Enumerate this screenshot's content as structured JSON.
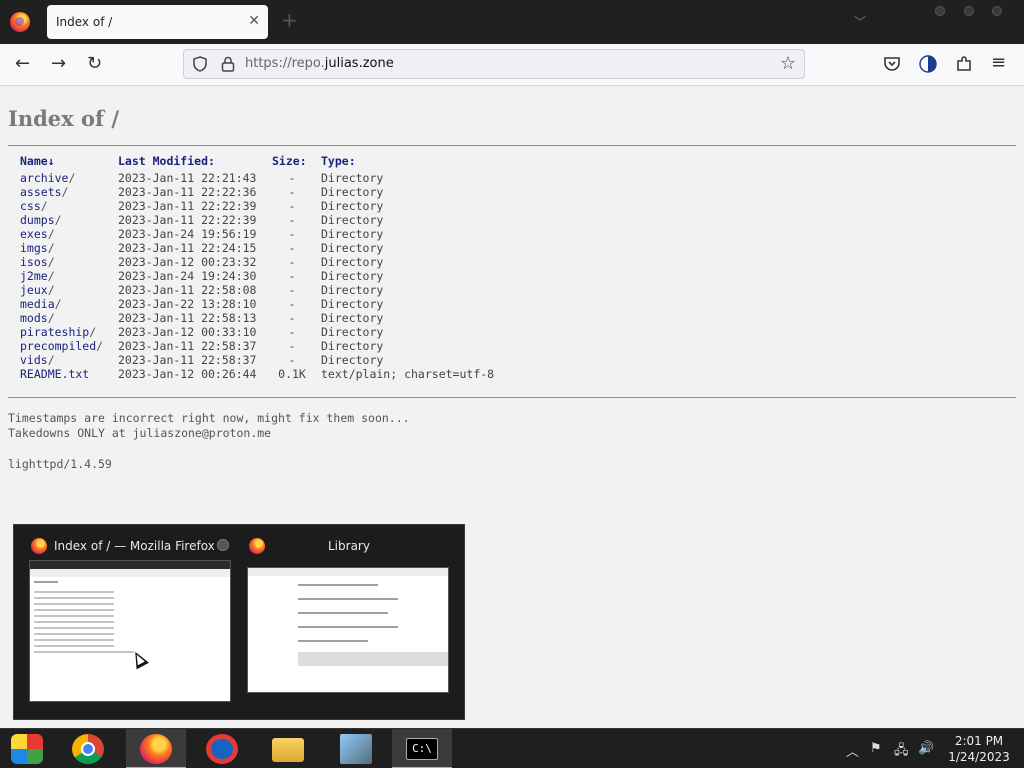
{
  "browser": {
    "tab_title": "Index of /",
    "url_prefix": "https://repo.",
    "url_domain": "julias.zone"
  },
  "page": {
    "title": "Index of /",
    "columns": {
      "name": "Name↓",
      "modified": "Last Modified:",
      "size": "Size:",
      "type": "Type:"
    },
    "rows": [
      {
        "name": "archive",
        "slash": "/",
        "modified": "2023-Jan-11 22:21:43",
        "size": "-",
        "type": "Directory"
      },
      {
        "name": "assets",
        "slash": "/",
        "modified": "2023-Jan-11 22:22:36",
        "size": "-",
        "type": "Directory"
      },
      {
        "name": "css",
        "slash": "/",
        "modified": "2023-Jan-11 22:22:39",
        "size": "-",
        "type": "Directory"
      },
      {
        "name": "dumps",
        "slash": "/",
        "modified": "2023-Jan-11 22:22:39",
        "size": "-",
        "type": "Directory"
      },
      {
        "name": "exes",
        "slash": "/",
        "modified": "2023-Jan-24 19:56:19",
        "size": "-",
        "type": "Directory"
      },
      {
        "name": "imgs",
        "slash": "/",
        "modified": "2023-Jan-11 22:24:15",
        "size": "-",
        "type": "Directory"
      },
      {
        "name": "isos",
        "slash": "/",
        "modified": "2023-Jan-12 00:23:32",
        "size": "-",
        "type": "Directory"
      },
      {
        "name": "j2me",
        "slash": "/",
        "modified": "2023-Jan-24 19:24:30",
        "size": "-",
        "type": "Directory"
      },
      {
        "name": "jeux",
        "slash": "/",
        "modified": "2023-Jan-11 22:58:08",
        "size": "-",
        "type": "Directory"
      },
      {
        "name": "media",
        "slash": "/",
        "modified": "2023-Jan-22 13:28:10",
        "size": "-",
        "type": "Directory"
      },
      {
        "name": "mods",
        "slash": "/",
        "modified": "2023-Jan-11 22:58:13",
        "size": "-",
        "type": "Directory"
      },
      {
        "name": "pirateship",
        "slash": "/",
        "modified": "2023-Jan-12 00:33:10",
        "size": "-",
        "type": "Directory"
      },
      {
        "name": "precompiled",
        "slash": "/",
        "modified": "2023-Jan-11 22:58:37",
        "size": "-",
        "type": "Directory"
      },
      {
        "name": "vids",
        "slash": "/",
        "modified": "2023-Jan-11 22:58:37",
        "size": "-",
        "type": "Directory"
      },
      {
        "name": "README.txt",
        "slash": "",
        "modified": "2023-Jan-12 00:26:44",
        "size": "0.1K",
        "type": "text/plain; charset=utf-8"
      }
    ],
    "footer_note_1": "Timestamps are incorrect right now, might fix them soon...",
    "footer_note_2": "Takedowns ONLY at juliaszone@proton.me",
    "server": "lighttpd/1.4.59"
  },
  "preview": {
    "window_1_title": "Index of / — Mozilla Firefox",
    "window_2_title": "Library"
  },
  "taskbar": {
    "apps": [
      "browser-launcher-icon",
      "chrome-icon",
      "firefox-icon",
      "opera-icon",
      "file-explorer-icon",
      "network-setup-icon",
      "command-prompt-icon"
    ],
    "time": "2:01 PM",
    "date": "1/24/2023"
  },
  "colors": {
    "link": "#1a237e",
    "accent": "#8ab4f8"
  }
}
